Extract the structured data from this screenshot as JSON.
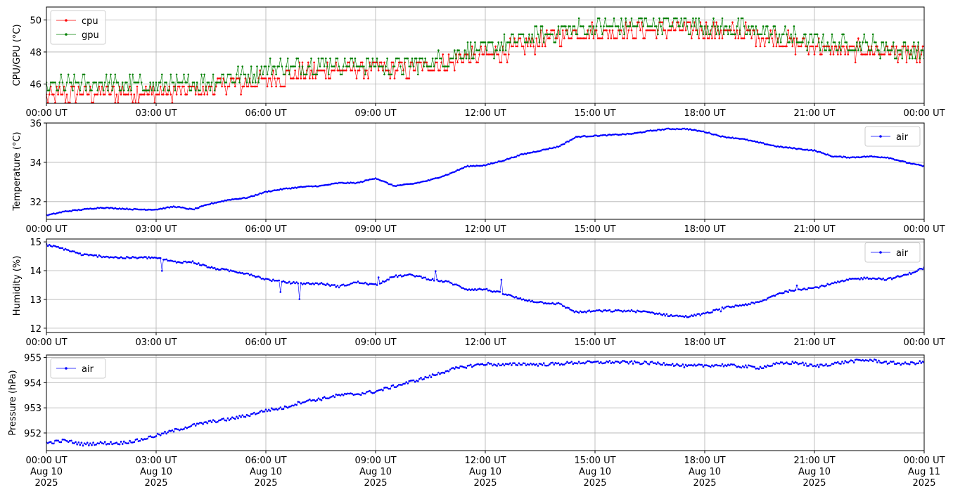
{
  "chart_data": [
    {
      "type": "line",
      "id": "cpu_gpu",
      "ylabel": "CPU/GPU (°C)",
      "ylim": [
        44.8,
        50.8
      ],
      "yticks": [
        46,
        48,
        50
      ],
      "xlim": [
        0,
        24
      ],
      "xtick_hours": [
        0,
        3,
        6,
        9,
        12,
        15,
        18,
        21,
        24
      ],
      "xtick_labels": [
        "00:00 UT",
        "03:00 UT",
        "06:00 UT",
        "09:00 UT",
        "12:00 UT",
        "15:00 UT",
        "18:00 UT",
        "21:00 UT",
        "00:00 UT"
      ],
      "grid": true,
      "legend": "top-left",
      "series": [
        {
          "name": "cpu",
          "color": "#ff0000",
          "x": [
            0,
            0.5,
            1,
            1.5,
            2,
            2.5,
            3,
            3.5,
            4,
            4.5,
            5,
            5.5,
            6,
            6.5,
            7,
            7.5,
            8,
            8.5,
            9,
            9.5,
            10,
            10.5,
            11,
            11.5,
            12,
            12.5,
            13,
            13.5,
            14,
            14.5,
            15,
            15.5,
            16,
            16.5,
            17,
            17.5,
            18,
            18.5,
            19,
            19.5,
            20,
            20.5,
            21,
            21.5,
            22,
            22.5,
            23,
            23.5,
            24
          ],
          "y": [
            45.3,
            45.5,
            45.6,
            45.6,
            45.6,
            45.6,
            45.6,
            45.6,
            45.7,
            45.9,
            46.1,
            46.1,
            46.4,
            46.6,
            46.9,
            47.0,
            47.1,
            47.1,
            47.1,
            47.0,
            47.0,
            47.2,
            47.5,
            47.8,
            47.9,
            48.1,
            48.5,
            48.8,
            49.1,
            49.3,
            49.3,
            49.4,
            49.4,
            49.5,
            49.6,
            49.6,
            49.5,
            49.4,
            49.3,
            49.2,
            48.9,
            48.7,
            48.5,
            48.3,
            48.2,
            48.3,
            48.2,
            48.1,
            48.0
          ]
        },
        {
          "name": "gpu",
          "color": "#008000",
          "x": [
            0,
            0.5,
            1,
            1.5,
            2,
            2.5,
            3,
            3.5,
            4,
            4.5,
            5,
            5.5,
            6,
            6.5,
            7,
            7.5,
            8,
            8.5,
            9,
            9.5,
            10,
            10.5,
            11,
            11.5,
            12,
            12.5,
            13,
            13.5,
            14,
            14.5,
            15,
            15.5,
            16,
            16.5,
            17,
            17.5,
            18,
            18.5,
            19,
            19.5,
            20,
            20.5,
            21,
            21.5,
            22,
            22.5,
            23,
            23.5,
            24
          ],
          "y": [
            45.6,
            45.8,
            45.9,
            45.9,
            45.9,
            45.8,
            45.8,
            45.8,
            45.9,
            46.1,
            46.3,
            46.5,
            46.8,
            46.9,
            47.1,
            47.2,
            47.2,
            47.2,
            47.1,
            47.0,
            47.1,
            47.3,
            47.6,
            47.9,
            48.1,
            48.3,
            48.7,
            49.0,
            49.2,
            49.3,
            49.4,
            49.5,
            49.6,
            49.7,
            49.7,
            49.6,
            49.5,
            49.4,
            49.3,
            49.2,
            49.0,
            48.8,
            48.6,
            48.4,
            48.3,
            48.3,
            48.2,
            48.0,
            48.0
          ]
        }
      ]
    },
    {
      "type": "line",
      "id": "temperature",
      "ylabel": "Temperature (°C)",
      "ylim": [
        31.1,
        36.0
      ],
      "yticks": [
        32,
        34,
        36
      ],
      "xlim": [
        0,
        24
      ],
      "xtick_hours": [
        0,
        3,
        6,
        9,
        12,
        15,
        18,
        21,
        24
      ],
      "xtick_labels": [
        "00:00 UT",
        "03:00 UT",
        "06:00 UT",
        "09:00 UT",
        "12:00 UT",
        "15:00 UT",
        "18:00 UT",
        "21:00 UT",
        "00:00 UT"
      ],
      "grid": true,
      "legend": "top-right",
      "series": [
        {
          "name": "air",
          "color": "#0000ff",
          "x": [
            0,
            0.5,
            1,
            1.5,
            2,
            2.5,
            3,
            3.5,
            4,
            4.5,
            5,
            5.5,
            6,
            6.5,
            7,
            7.5,
            8,
            8.5,
            9,
            9.5,
            10,
            10.5,
            11,
            11.5,
            12,
            12.5,
            13,
            13.5,
            14,
            14.5,
            15,
            15.5,
            16,
            16.5,
            17,
            17.5,
            18,
            18.5,
            19,
            19.5,
            20,
            20.5,
            21,
            21.5,
            22,
            22.5,
            23,
            23.5,
            24
          ],
          "y": [
            31.3,
            31.5,
            31.6,
            31.7,
            31.65,
            31.6,
            31.6,
            31.75,
            31.6,
            31.9,
            32.1,
            32.2,
            32.5,
            32.65,
            32.75,
            32.8,
            32.95,
            32.95,
            33.2,
            32.8,
            32.9,
            33.1,
            33.4,
            33.8,
            33.85,
            34.1,
            34.4,
            34.6,
            34.8,
            35.3,
            35.35,
            35.4,
            35.45,
            35.6,
            35.7,
            35.7,
            35.55,
            35.3,
            35.2,
            35.0,
            34.8,
            34.7,
            34.6,
            34.3,
            34.25,
            34.3,
            34.25,
            34.0,
            33.8
          ]
        }
      ]
    },
    {
      "type": "line",
      "id": "humidity",
      "ylabel": "Humidity (%)",
      "ylim": [
        11.85,
        15.1
      ],
      "yticks": [
        12,
        13,
        14,
        15
      ],
      "xlim": [
        0,
        24
      ],
      "xtick_hours": [
        0,
        3,
        6,
        9,
        12,
        15,
        18,
        21,
        24
      ],
      "xtick_labels": [
        "00:00 UT",
        "03:00 UT",
        "06:00 UT",
        "09:00 UT",
        "12:00 UT",
        "15:00 UT",
        "18:00 UT",
        "21:00 UT",
        "00:00 UT"
      ],
      "grid": true,
      "legend": "top-right",
      "series": [
        {
          "name": "air",
          "color": "#0000ff",
          "x": [
            0,
            0.5,
            1,
            1.5,
            2,
            2.5,
            3,
            3.5,
            4,
            4.5,
            5,
            5.5,
            6,
            6.5,
            7,
            7.5,
            8,
            8.5,
            9,
            9.5,
            10,
            10.5,
            11,
            11.5,
            12,
            12.5,
            13,
            13.5,
            14,
            14.5,
            15,
            15.5,
            16,
            16.5,
            17,
            17.5,
            18,
            18.5,
            19,
            19.5,
            20,
            20.5,
            21,
            21.5,
            22,
            22.5,
            23,
            23.5,
            24
          ],
          "y": [
            14.9,
            14.75,
            14.55,
            14.5,
            14.45,
            14.45,
            14.45,
            14.3,
            14.3,
            14.1,
            14.0,
            13.9,
            13.7,
            13.6,
            13.55,
            13.55,
            13.45,
            13.6,
            13.5,
            13.8,
            13.85,
            13.7,
            13.6,
            13.35,
            13.35,
            13.2,
            13.0,
            12.9,
            12.85,
            12.55,
            12.6,
            12.6,
            12.6,
            12.55,
            12.45,
            12.4,
            12.5,
            12.7,
            12.8,
            12.9,
            13.2,
            13.35,
            13.4,
            13.55,
            13.7,
            13.75,
            13.7,
            13.85,
            14.1
          ]
        }
      ]
    },
    {
      "type": "line",
      "id": "pressure",
      "ylabel": "Pressure (hPa)",
      "ylim": [
        951.3,
        955.1
      ],
      "yticks": [
        952,
        953,
        954,
        955
      ],
      "xlim": [
        0,
        24
      ],
      "xtick_hours": [
        0,
        3,
        6,
        9,
        12,
        15,
        18,
        21,
        24
      ],
      "xtick_labels": [
        "00:00 UT\nAug 10\n2025",
        "03:00 UT\nAug 10\n2025",
        "06:00 UT\nAug 10\n2025",
        "09:00 UT\nAug 10\n2025",
        "12:00 UT\nAug 10\n2025",
        "15:00 UT\nAug 10\n2025",
        "18:00 UT\nAug 10\n2025",
        "21:00 UT\nAug 10\n2025",
        "00:00 UT\nAug 11\n2025"
      ],
      "grid": true,
      "legend": "top-left",
      "series": [
        {
          "name": "air",
          "color": "#0000ff",
          "x": [
            0,
            0.5,
            1,
            1.5,
            2,
            2.5,
            3,
            3.5,
            4,
            4.5,
            5,
            5.5,
            6,
            6.5,
            7,
            7.5,
            8,
            8.5,
            9,
            9.5,
            10,
            10.5,
            11,
            11.5,
            12,
            12.5,
            13,
            13.5,
            14,
            14.5,
            15,
            15.5,
            16,
            16.5,
            17,
            17.5,
            18,
            18.5,
            19,
            19.5,
            20,
            20.5,
            21,
            21.5,
            22,
            22.5,
            23,
            23.5,
            24
          ],
          "y": [
            951.6,
            951.7,
            951.55,
            951.6,
            951.6,
            951.7,
            951.9,
            952.1,
            952.3,
            952.45,
            952.55,
            952.7,
            952.9,
            953.0,
            953.25,
            953.35,
            953.5,
            953.55,
            953.65,
            953.85,
            954.05,
            954.25,
            954.5,
            954.65,
            954.75,
            954.7,
            954.75,
            954.72,
            954.75,
            954.8,
            954.8,
            954.82,
            954.8,
            954.78,
            954.75,
            954.65,
            954.68,
            954.7,
            954.65,
            954.6,
            954.75,
            954.8,
            954.65,
            954.75,
            954.85,
            954.9,
            954.8,
            954.75,
            954.82
          ]
        }
      ]
    }
  ]
}
